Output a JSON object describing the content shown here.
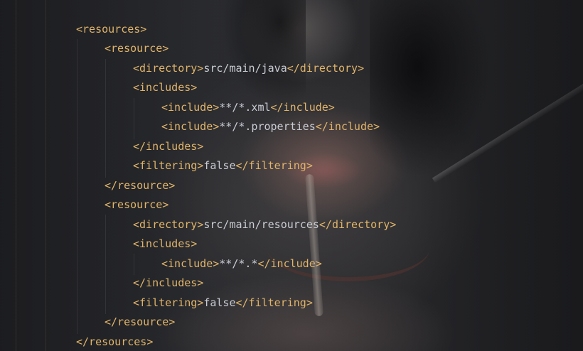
{
  "editor": {
    "lines": [
      {
        "open": "<resources>",
        "text": "",
        "close": ""
      },
      {
        "open": "<resource>",
        "text": "",
        "close": ""
      },
      {
        "open": "<directory>",
        "text": "src/main/java",
        "close": "</directory>"
      },
      {
        "open": "<includes>",
        "text": "",
        "close": ""
      },
      {
        "open": "<include>",
        "text": "**/*.xml",
        "close": "</include>"
      },
      {
        "open": "<include>",
        "text": "**/*.properties",
        "close": "</include>"
      },
      {
        "open": "</includes>",
        "text": "",
        "close": ""
      },
      {
        "open": "<filtering>",
        "text": "false",
        "close": "</filtering>"
      },
      {
        "open": "</resource>",
        "text": "",
        "close": ""
      },
      {
        "open": "<resource>",
        "text": "",
        "close": ""
      },
      {
        "open": "<directory>",
        "text": "src/main/resources",
        "close": "</directory>"
      },
      {
        "open": "<includes>",
        "text": "",
        "close": ""
      },
      {
        "open": "<include>",
        "text": "**/*.*",
        "close": "</include>"
      },
      {
        "open": "</includes>",
        "text": "",
        "close": ""
      },
      {
        "open": "<filtering>",
        "text": "false",
        "close": "</filtering>"
      },
      {
        "open": "</resource>",
        "text": "",
        "close": ""
      },
      {
        "open": "</resources>",
        "text": "",
        "close": ""
      }
    ]
  },
  "colors": {
    "tag": "#e0b46a",
    "text": "#c9ccd3",
    "background": "#1e1f22"
  }
}
